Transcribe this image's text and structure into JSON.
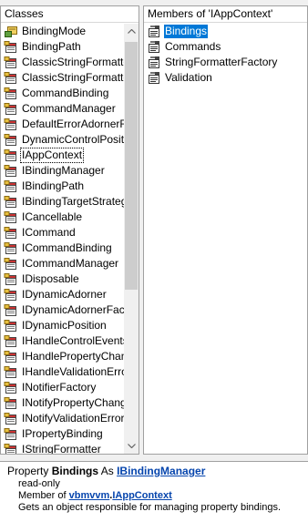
{
  "classes": {
    "header": "Classes",
    "items": [
      {
        "label": "BindingMode",
        "icon": "enum-icon"
      },
      {
        "label": "BindingPath",
        "icon": "class-icon"
      },
      {
        "label": "ClassicStringFormatter",
        "icon": "class-icon"
      },
      {
        "label": "ClassicStringFormatterFactory",
        "icon": "class-icon"
      },
      {
        "label": "CommandBinding",
        "icon": "class-icon"
      },
      {
        "label": "CommandManager",
        "icon": "class-icon"
      },
      {
        "label": "DefaultErrorAdornerFactory",
        "icon": "class-icon"
      },
      {
        "label": "DynamicControlPosition",
        "icon": "class-icon"
      },
      {
        "label": "IAppContext",
        "icon": "class-icon",
        "focused": true
      },
      {
        "label": "IBindingManager",
        "icon": "class-icon"
      },
      {
        "label": "IBindingPath",
        "icon": "class-icon"
      },
      {
        "label": "IBindingTargetStrategy",
        "icon": "class-icon"
      },
      {
        "label": "ICancellable",
        "icon": "class-icon"
      },
      {
        "label": "ICommand",
        "icon": "class-icon"
      },
      {
        "label": "ICommandBinding",
        "icon": "class-icon"
      },
      {
        "label": "ICommandManager",
        "icon": "class-icon"
      },
      {
        "label": "IDisposable",
        "icon": "class-icon"
      },
      {
        "label": "IDynamicAdorner",
        "icon": "class-icon"
      },
      {
        "label": "IDynamicAdornerFactory",
        "icon": "class-icon"
      },
      {
        "label": "IDynamicPosition",
        "icon": "class-icon"
      },
      {
        "label": "IHandleControlEvents",
        "icon": "class-icon"
      },
      {
        "label": "IHandlePropertyChanged",
        "icon": "class-icon"
      },
      {
        "label": "IHandleValidationErrors",
        "icon": "class-icon"
      },
      {
        "label": "INotifierFactory",
        "icon": "class-icon"
      },
      {
        "label": "INotifyPropertyChanged",
        "icon": "class-icon"
      },
      {
        "label": "INotifyValidationError",
        "icon": "class-icon"
      },
      {
        "label": "IPropertyBinding",
        "icon": "class-icon"
      },
      {
        "label": "IStringFormatter",
        "icon": "class-icon"
      }
    ]
  },
  "members": {
    "header": "Members of 'IAppContext'",
    "items": [
      {
        "label": "Bindings",
        "icon": "property-icon",
        "selected": true
      },
      {
        "label": "Commands",
        "icon": "property-icon"
      },
      {
        "label": "StringFormatterFactory",
        "icon": "property-icon"
      },
      {
        "label": "Validation",
        "icon": "property-icon"
      }
    ]
  },
  "details": {
    "kind_label": "Property",
    "member_name": "Bindings",
    "as_label": "As",
    "type_name": "IBindingManager",
    "access": "read-only",
    "member_of_label": "Member of",
    "project": "vbmvvm",
    "project_class_separator": ".",
    "class_name": "IAppContext",
    "description": "Gets an object responsible for managing property bindings."
  },
  "colors": {
    "selection": "#0078d7",
    "link": "#0645ad"
  }
}
